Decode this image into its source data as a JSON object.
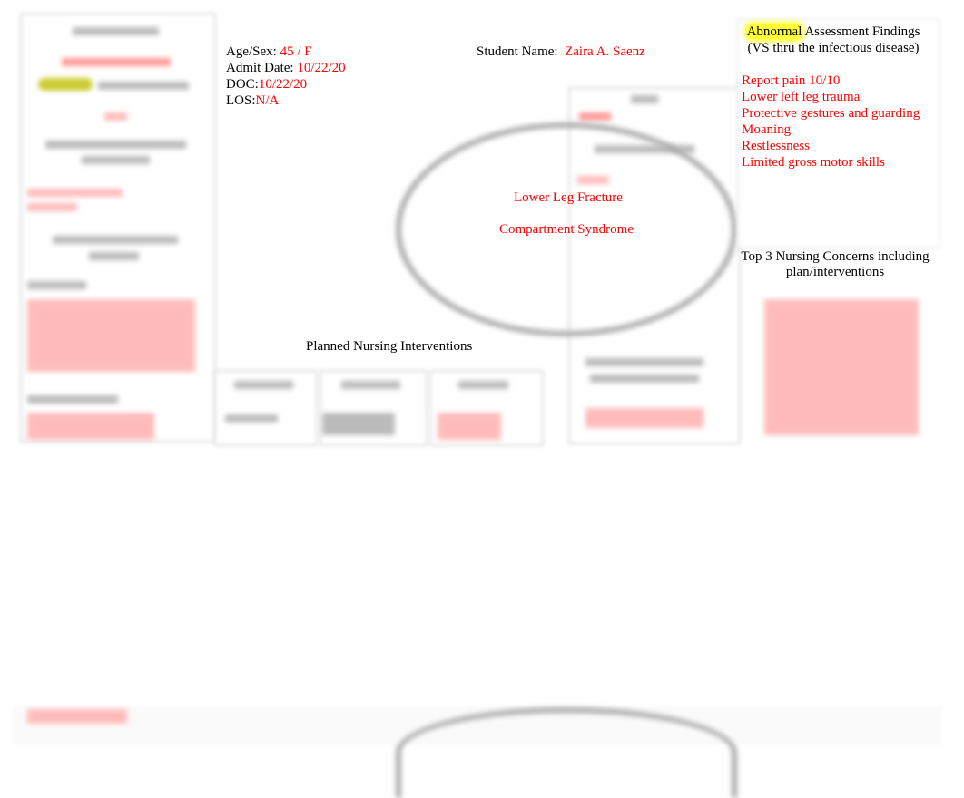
{
  "patient": {
    "age_sex_label": "Age/Sex:",
    "age_sex_value": "45 / F",
    "admit_label": "Admit Date:",
    "admit_value": "10/22/20",
    "doc_label": "DOC:",
    "doc_value": "10/22/20",
    "los_label": "LOS:",
    "los_value": "N/A"
  },
  "student": {
    "label": "Student Name:",
    "value": "Zaira A. Saenz"
  },
  "diagnosis": {
    "primary": "Lower Leg Fracture",
    "secondary": "Compartment Syndrome"
  },
  "planned_interventions_title": "Planned Nursing Interventions",
  "abnormal": {
    "title_highlight": "Abnormal",
    "title_rest": "Assessment Findings",
    "subtitle": "(VS thru the infectious disease)",
    "items": [
      "Report pain 10/10",
      "Lower left leg trauma",
      "Protective gestures and guarding",
      "Moaning",
      "Restlessness",
      "Limited gross motor skills"
    ]
  },
  "concerns_title": "Top 3 Nursing Concerns including plan/interventions",
  "colors": {
    "value_text": "#ff0000",
    "highlight": "#ffff33"
  }
}
